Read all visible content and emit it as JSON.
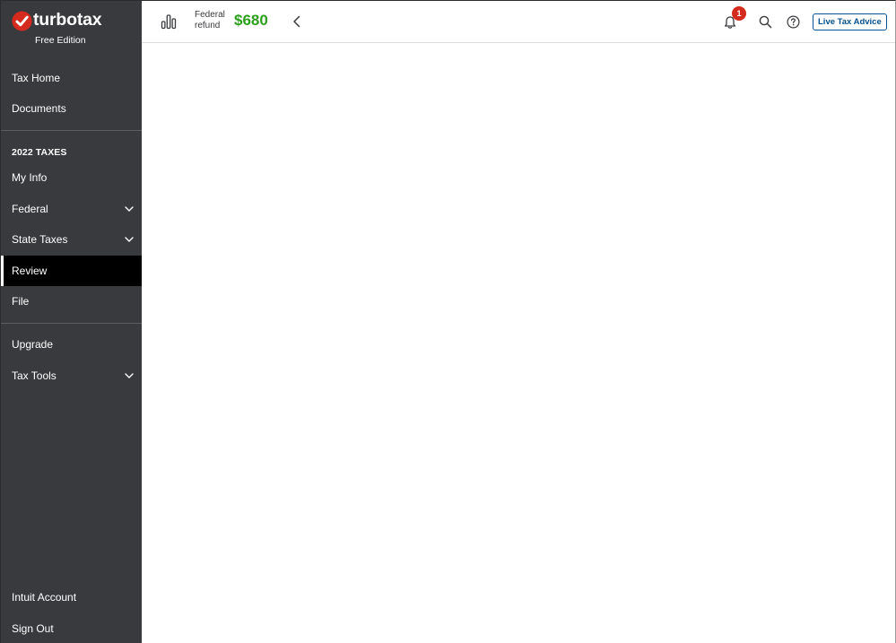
{
  "brand": {
    "name": "turbotax",
    "edition": "Free Edition",
    "check_color": "#d52b1e"
  },
  "sidebar": {
    "top_items": [
      {
        "label": "Tax Home"
      },
      {
        "label": "Documents"
      }
    ],
    "section_label": "2022 TAXES",
    "tax_items": [
      {
        "label": "My Info",
        "expandable": false,
        "active": false
      },
      {
        "label": "Federal",
        "expandable": true,
        "active": false
      },
      {
        "label": "State Taxes",
        "expandable": true,
        "active": false
      },
      {
        "label": "Review",
        "expandable": false,
        "active": true
      },
      {
        "label": "File",
        "expandable": false,
        "active": false
      }
    ],
    "extra_items": [
      {
        "label": "Upgrade",
        "expandable": false
      },
      {
        "label": "Tax Tools",
        "expandable": true
      }
    ],
    "bottom_items": [
      {
        "label": "Intuit Account"
      },
      {
        "label": "Sign Out"
      }
    ]
  },
  "header": {
    "refund_label_line1": "Federal",
    "refund_label_line2": "refund",
    "refund_amount": "$680",
    "refund_color": "#2ca01c",
    "notification_count": "1",
    "live_button_label": "Live Tax Advice",
    "icons": [
      "bar-chart-icon",
      "chevron-left-icon",
      "bell-icon",
      "search-icon",
      "help-icon"
    ]
  },
  "colors": {
    "sidebar_bg": "#393a3d",
    "active_bg": "#000000",
    "accent_blue": "#055393",
    "badge_red": "#d52b1e"
  }
}
